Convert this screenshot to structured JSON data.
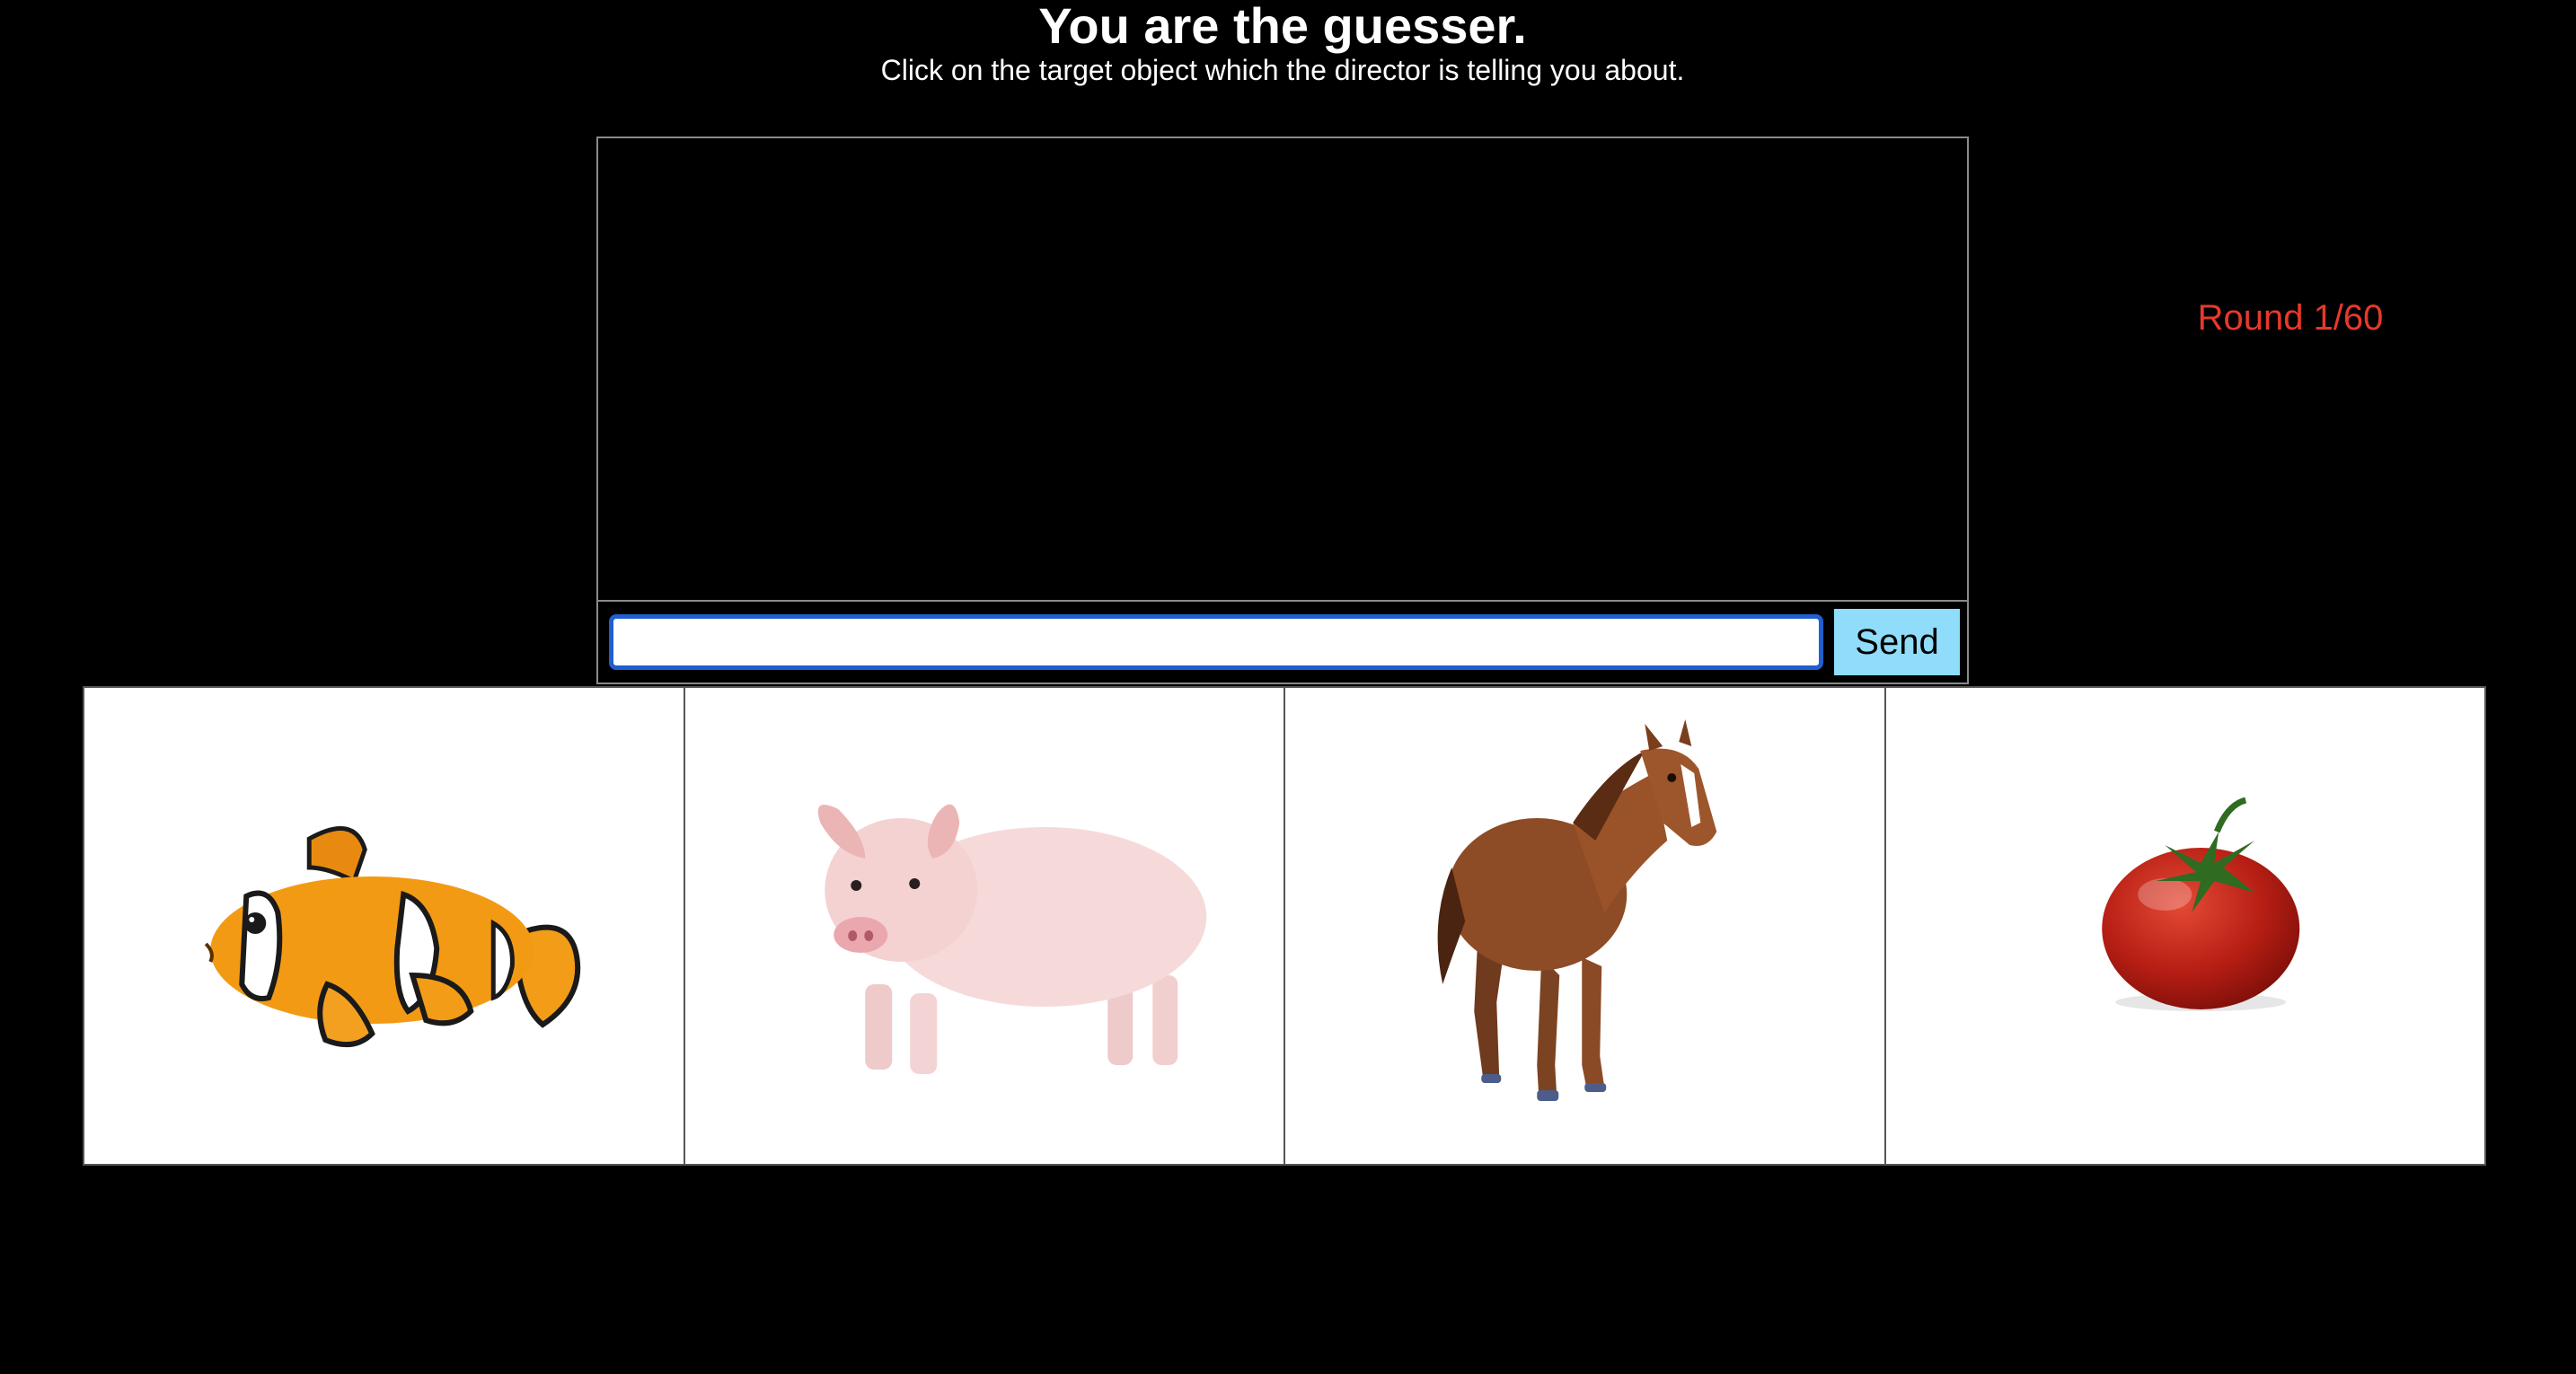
{
  "header": {
    "title": "You are the guesser.",
    "subtitle": "Click on the target object which the director is telling you about."
  },
  "chat": {
    "input_value": "",
    "send_label": "Send"
  },
  "round": {
    "label": "Round 1/60",
    "current": 1,
    "total": 60,
    "color": "#e8382b"
  },
  "objects": [
    {
      "icon": "clownfish-icon"
    },
    {
      "icon": "pig-icon"
    },
    {
      "icon": "horse-icon"
    },
    {
      "icon": "tomato-icon"
    }
  ],
  "colors": {
    "background": "#000000",
    "send_button": "#8fdcfb",
    "input_focus": "#1f5fce"
  }
}
